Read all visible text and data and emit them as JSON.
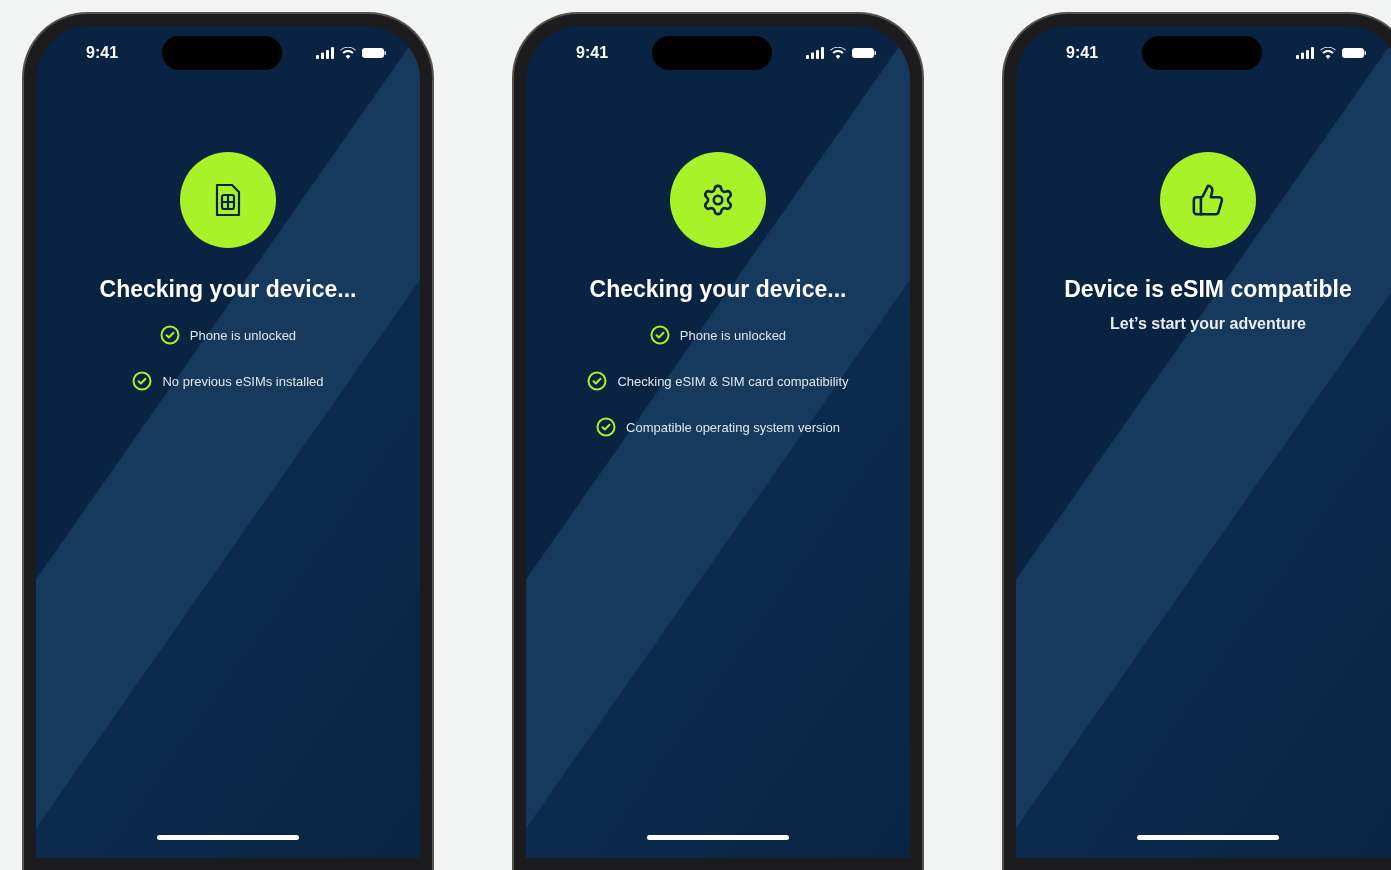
{
  "phones": [
    {
      "status_bar": {
        "time": "9:41"
      },
      "kind": "sim",
      "title": "Checking your device...",
      "checks": [
        {
          "label": "Phone is unlocked",
          "checked": true
        },
        {
          "label": "No previous eSIMs installed",
          "checked": true
        }
      ]
    },
    {
      "status_bar": {
        "time": "9:41"
      },
      "kind": "gear",
      "title": "Checking your device...",
      "checks": [
        {
          "label": "Phone is unlocked",
          "checked": true
        },
        {
          "label": "Checking eSIM & SIM card compatibility",
          "checked": true
        },
        {
          "label": "Compatible operating system version",
          "checked": true
        }
      ]
    },
    {
      "status_bar": {
        "time": "9:41"
      },
      "kind": "thumbs-up",
      "title": "Device is eSIM compatible",
      "subtitle": "Let’s start your adventure"
    }
  ]
}
